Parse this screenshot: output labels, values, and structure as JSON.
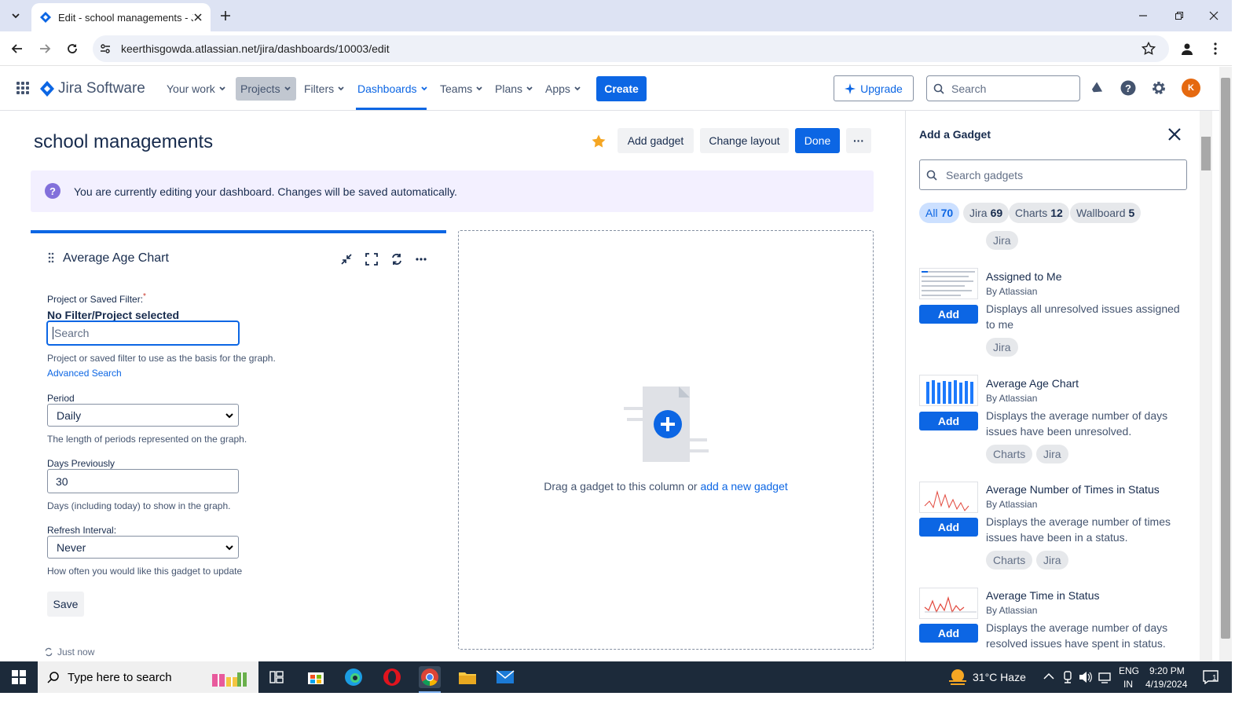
{
  "browser": {
    "tab_title": "Edit - school managements - Ji",
    "url": "keerthisgowda.atlassian.net/jira/dashboards/10003/edit"
  },
  "header": {
    "product": "Jira Software",
    "nav": [
      "Your work",
      "Projects",
      "Filters",
      "Dashboards",
      "Teams",
      "Plans",
      "Apps"
    ],
    "create": "Create",
    "upgrade": "Upgrade",
    "search_placeholder": "Search",
    "avatar": "K"
  },
  "page": {
    "title": "school managements",
    "add_gadget": "Add gadget",
    "change_layout": "Change layout",
    "done": "Done",
    "more": "···",
    "banner": "You are currently editing your dashboard. Changes will be saved automatically."
  },
  "gadget": {
    "title": "Average Age Chart",
    "filter_label": "Project or Saved Filter:",
    "required": "*",
    "no_filter": "No Filter/Project selected",
    "search_placeholder": "Search",
    "filter_help": "Project or saved filter to use as the basis for the graph.",
    "advanced_search": "Advanced Search",
    "period_label": "Period",
    "period_value": "Daily",
    "period_help": "The length of periods represented on the graph.",
    "days_label": "Days Previously",
    "days_value": "30",
    "days_help": "Days (including today) to show in the graph.",
    "refresh_label": "Refresh Interval:",
    "refresh_value": "Never",
    "refresh_help": "How often you would like this gadget to update",
    "save": "Save",
    "updated": "Just now"
  },
  "dropzone": {
    "text": "Drag a gadget to this column or ",
    "link": "add a new gadget"
  },
  "side": {
    "title": "Add a Gadget",
    "search_placeholder": "Search gadgets",
    "filters": [
      {
        "label": "All",
        "count": "70"
      },
      {
        "label": "Jira",
        "count": "69"
      },
      {
        "label": "Charts",
        "count": "12"
      },
      {
        "label": "Wallboard",
        "count": "5"
      }
    ],
    "top_tag": "Jira",
    "add_label": "Add",
    "items": [
      {
        "name": "Assigned to Me",
        "by": "By Atlassian",
        "desc": "Displays all unresolved issues assigned to me",
        "tags": [
          "Jira"
        ]
      },
      {
        "name": "Average Age Chart",
        "by": "By Atlassian",
        "desc": "Displays the average number of days issues have been unresolved.",
        "tags": [
          "Charts",
          "Jira"
        ]
      },
      {
        "name": "Average Number of Times in Status",
        "by": "By Atlassian",
        "desc": "Displays the average number of times issues have been in a status.",
        "tags": [
          "Charts",
          "Jira"
        ]
      },
      {
        "name": "Average Time in Status",
        "by": "By Atlassian",
        "desc": "Displays the average number of days resolved issues have spent in status.",
        "tags": []
      }
    ]
  },
  "taskbar": {
    "search": "Type here to search",
    "weather": "31°C Haze",
    "lang1": "ENG",
    "lang2": "IN",
    "time": "9:20 PM",
    "date": "4/19/2024",
    "notif": "1"
  },
  "colors": {
    "primary": "#0c66e4",
    "banner_bg": "#f3f0ff",
    "star": "#f5a623"
  }
}
